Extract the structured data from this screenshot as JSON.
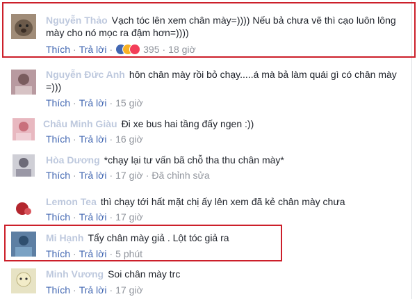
{
  "actions": {
    "like": "Thích",
    "reply": "Trả lời",
    "edited": "Đã chỉnh sửa"
  },
  "comments": [
    {
      "name": "Nguyễn Thảo",
      "text": "Vạch tóc lên xem chân mày=)))) Nếu bả chưa vẽ thì cạo luôn lông mày cho nó mọc ra đậm hơn=))))",
      "reaction_count": "395",
      "time": "18 giờ",
      "reactions": [
        "like",
        "haha",
        "love"
      ]
    },
    {
      "name": "Nguyễn Đức Anh",
      "text": "hôn chân mày rồi bỏ chạy.....á mà bả làm quái gì có chân mày =)))",
      "time": "15 giờ"
    },
    {
      "name": "Châu Minh Giàu",
      "text": "Đi xe bus hai tầng đấy ngen :))",
      "time": "16 giờ"
    },
    {
      "name": "Hòa Dương",
      "text": "*chạy lại tư vấn bã chỗ tha thu chân mày*",
      "time": "17 giờ",
      "edited": true
    },
    {
      "name": "Lemon Tea",
      "text": "thì chạy tới hất mặt chị ấy lên xem đã kẻ chân mày chưa",
      "time": "17 giờ"
    },
    {
      "name": "Mi Hạnh",
      "text": "Tẩy chân mày giả . Lột tóc giả ra",
      "time": "5 phút"
    },
    {
      "name": "Minh Vương",
      "text": "Soi chân mày trc",
      "time": "17 giờ"
    }
  ],
  "colors": {
    "link": "#4267b2",
    "meta": "#90949c",
    "highlight": "#cc1f2a"
  }
}
